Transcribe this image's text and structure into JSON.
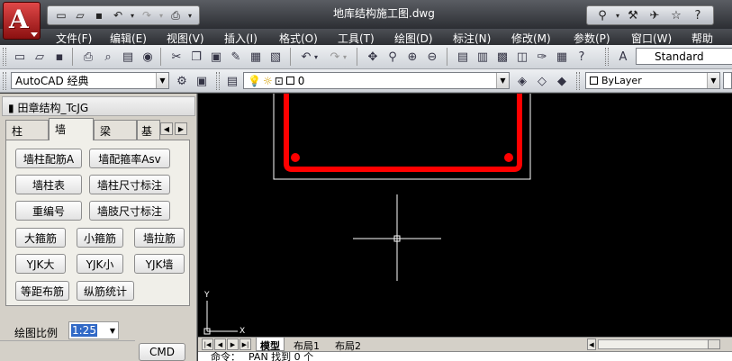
{
  "window": {
    "title": "地库结构施工图.dwg"
  },
  "menu": [
    "文件(F)",
    "编辑(E)",
    "视图(V)",
    "插入(I)",
    "格式(O)",
    "工具(T)",
    "绘图(D)",
    "标注(N)",
    "修改(M)",
    "参数(P)",
    "窗口(W)",
    "帮助"
  ],
  "toolbar": {
    "text_style": "Standard",
    "workspace": "AutoCAD 经典",
    "layer": "0",
    "color": "ByLayer"
  },
  "palette": {
    "title": "田章结构_TcJG",
    "tabs": [
      "柱",
      "墙",
      "梁",
      "基"
    ],
    "active_tab": "墙",
    "buttons": [
      "墙柱配筋A",
      "墙配箍率Asv",
      "墙柱表",
      "墙柱尺寸标注",
      "重编号",
      "墙肢尺寸标注",
      "大箍筋",
      "小箍筋",
      "墙拉筋",
      "YJK大",
      "YJK小",
      "YJK墙",
      "等距布筋",
      "纵筋统计"
    ],
    "scale_label": "绘图比例",
    "scale_value": "1:25",
    "cmd_button": "CMD"
  },
  "layout_tabs": [
    "模型",
    "布局1",
    "布局2"
  ],
  "ucs": {
    "x": "X",
    "y": "Y"
  },
  "command_line": "命令：  _PAN  找到 0 个",
  "colors": {
    "rebar": "#ff0000",
    "canvas": "#000000"
  }
}
